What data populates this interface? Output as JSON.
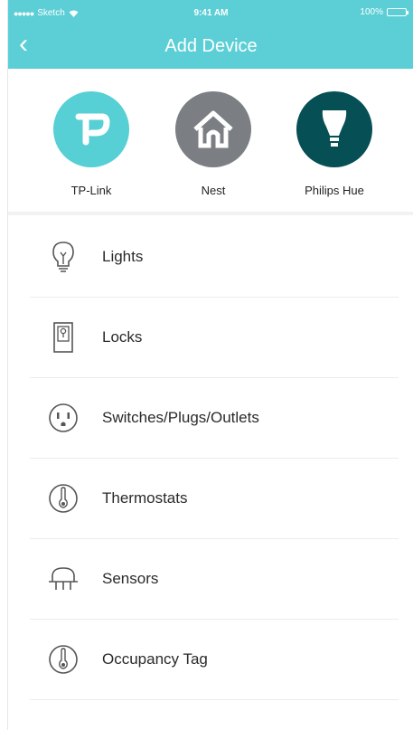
{
  "status": {
    "carrier": "Sketch",
    "time": "9:41 AM",
    "battery": "100%"
  },
  "header": {
    "back_icon": "chevron-left-icon",
    "back_glyph": "‹",
    "title": "Add Device"
  },
  "colors": {
    "header": "#5ccfd6",
    "tplink": "#56cfd5",
    "nest": "#7b7f83",
    "hue": "#064f55"
  },
  "brands": [
    {
      "label": "TP-Link",
      "icon": "tplink-logo-icon"
    },
    {
      "label": "Nest",
      "icon": "nest-home-icon"
    },
    {
      "label": "Philips Hue",
      "icon": "hue-bulb-icon"
    }
  ],
  "categories": [
    {
      "label": "Lights",
      "icon": "bulb-icon"
    },
    {
      "label": "Locks",
      "icon": "lock-icon"
    },
    {
      "label": "Switches/Plugs/Outlets",
      "icon": "outlet-icon"
    },
    {
      "label": "Thermostats",
      "icon": "thermostat-icon"
    },
    {
      "label": "Sensors",
      "icon": "sensor-icon"
    },
    {
      "label": "Occupancy Tag",
      "icon": "occupancy-tag-icon"
    }
  ]
}
